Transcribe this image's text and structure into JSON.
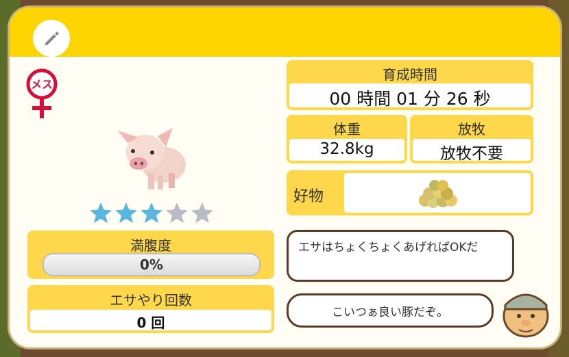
{
  "gender_label": "メス",
  "stars": {
    "rating": 3,
    "max": 5
  },
  "fullness": {
    "label": "満腹度",
    "value_text": "0%",
    "fraction": 0
  },
  "feed_count": {
    "label": "エサやり回数",
    "value": "0 回"
  },
  "raising_time": {
    "label": "育成時間",
    "value": "00 時間 01 分 26 秒"
  },
  "weight": {
    "label": "体重",
    "value": "32.8kg"
  },
  "grazing": {
    "label": "放牧",
    "value": "放牧不要"
  },
  "favorite": {
    "label": "好物"
  },
  "bubbles": {
    "advice": "エサはちょくちょくあげればOKだ",
    "comment": "こいつぁ良い豚だぞ。"
  },
  "colors": {
    "header": "#ffd400",
    "star_on": "#5ab6e0",
    "star_off": "#b8bcc4",
    "gender": "#d4103a"
  },
  "icons": {
    "edit": "pencil-icon",
    "gender": "female-icon",
    "favorite_food": "feed-pile-icon"
  }
}
